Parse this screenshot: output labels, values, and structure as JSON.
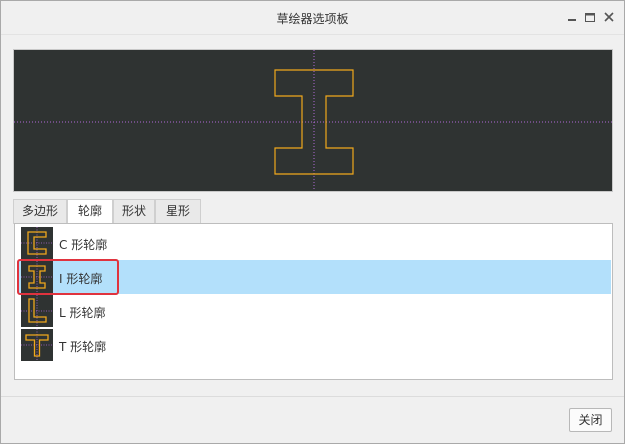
{
  "window": {
    "title": "草绘器选项板"
  },
  "tabs": [
    {
      "label": "多边形",
      "active": false
    },
    {
      "label": "轮廓",
      "active": true
    },
    {
      "label": "形状",
      "active": false
    },
    {
      "label": "星形",
      "active": false
    }
  ],
  "list": {
    "items": [
      {
        "label": "C 形轮廓",
        "icon": "c-profile-icon",
        "selected": false
      },
      {
        "label": "I 形轮廓",
        "icon": "i-profile-icon",
        "selected": true
      },
      {
        "label": "L 形轮廓",
        "icon": "l-profile-icon",
        "selected": false
      },
      {
        "label": "T 形轮廓",
        "icon": "t-profile-icon",
        "selected": false
      }
    ]
  },
  "footer": {
    "close_label": "关闭"
  },
  "colors": {
    "preview_bg": "#2f3332",
    "shape_stroke": "#f0a81c",
    "axis_line": "#b06ad8",
    "selection_bg": "#b3e0fb",
    "highlight_border": "#e0333e"
  }
}
